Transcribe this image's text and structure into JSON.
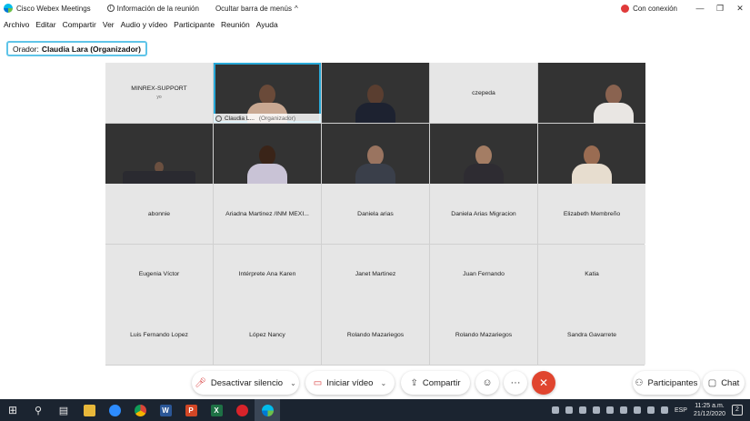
{
  "window": {
    "app_title": "Cisco Webex Meetings",
    "meeting_info": "Información de la reunión",
    "hide_menu": "Ocultar barra de menús",
    "connection": "Con conexión",
    "controls": {
      "minimize": "—",
      "maximize": "❐",
      "close": "✕"
    }
  },
  "menu": [
    "Archivo",
    "Editar",
    "Compartir",
    "Ver",
    "Audio y vídeo",
    "Participante",
    "Reunión",
    "Ayuda"
  ],
  "speaker": {
    "label": "Orador:",
    "name": "Claudia Lara (Organizador)"
  },
  "tiles": [
    {
      "name": "MINREX-SUPPORT",
      "sub": "yo"
    },
    {
      "name": "Claudia L...",
      "org": "(Organizador)"
    },
    {
      "name": ""
    },
    {
      "name": "czepeda"
    },
    {
      "name": ""
    },
    {
      "name": ""
    },
    {
      "name": ""
    },
    {
      "name": ""
    },
    {
      "name": ""
    },
    {
      "name": ""
    },
    {
      "name": "abonnie"
    },
    {
      "name": "Ariadna Martinez /INM MEXI..."
    },
    {
      "name": "Daniela arias"
    },
    {
      "name": "Daniela Arias Migracion"
    },
    {
      "name": "Elizabeth Membreño"
    },
    {
      "name": "Eugenia Víctor"
    },
    {
      "name": "Intérprete Ana Karen"
    },
    {
      "name": "Janet Martinez"
    },
    {
      "name": "Juan Fernando"
    },
    {
      "name": "Katia"
    },
    {
      "name": "Luis Fernando Lopez"
    },
    {
      "name": "López Nancy"
    },
    {
      "name": "Rolando Mazariegos"
    },
    {
      "name": "Rolando Mazariegos"
    },
    {
      "name": "Sandra Gavarrete"
    }
  ],
  "toolbar": {
    "mute": "Desactivar silencio",
    "video": "Iniciar vídeo",
    "share": "Compartir",
    "participants": "Participantes",
    "chat": "Chat",
    "more": "···",
    "end": "✕"
  },
  "taskbar": {
    "lang": "ESP",
    "time": "11:25 a.m.",
    "date": "21/12/2020",
    "notifications": "2"
  }
}
